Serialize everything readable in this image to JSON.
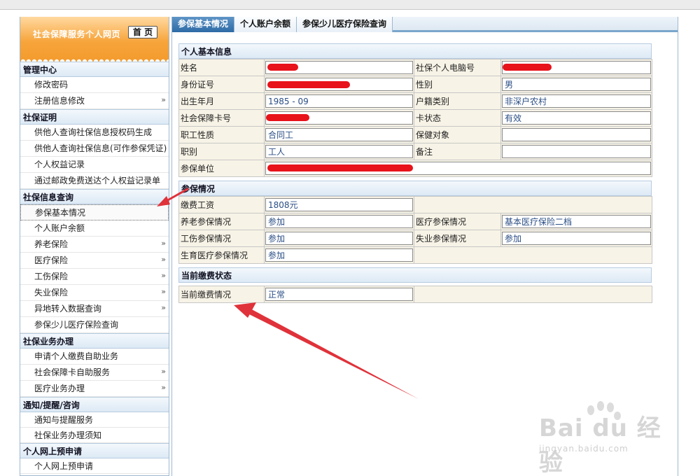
{
  "sidebar": {
    "title": "社会保障服务个人网页",
    "home_button": "首 页",
    "sections": [
      {
        "title": "管理中心",
        "items": [
          {
            "label": "修改密码",
            "arrow": false
          },
          {
            "label": "注册信息修改",
            "arrow": true
          }
        ]
      },
      {
        "title": "社保证明",
        "items": [
          {
            "label": "供他人查询社保信息授权码生成",
            "arrow": false
          },
          {
            "label": "供他人查询社保信息(可作参保凭证)",
            "arrow": false
          },
          {
            "label": "个人权益记录",
            "arrow": false
          },
          {
            "label": "通过邮政免费送达个人权益记录单",
            "arrow": false
          }
        ]
      },
      {
        "title": "社保信息查询",
        "items": [
          {
            "label": "参保基本情况",
            "arrow": false,
            "active": true
          },
          {
            "label": "个人账户余额",
            "arrow": false
          },
          {
            "label": "养老保险",
            "arrow": true
          },
          {
            "label": "医疗保险",
            "arrow": true
          },
          {
            "label": "工伤保险",
            "arrow": true
          },
          {
            "label": "失业保险",
            "arrow": true
          },
          {
            "label": "异地转入数据查询",
            "arrow": true
          },
          {
            "label": "参保少儿医疗保险查询",
            "arrow": false
          }
        ]
      },
      {
        "title": "社保业务办理",
        "items": [
          {
            "label": "申请个人缴费自助业务",
            "arrow": false
          },
          {
            "label": "社会保障卡自助服务",
            "arrow": true
          },
          {
            "label": "医疗业务办理",
            "arrow": true
          }
        ]
      },
      {
        "title": "通知/提醒/咨询",
        "items": [
          {
            "label": "通知与提醒服务",
            "arrow": false
          },
          {
            "label": "社保业务办理须知",
            "arrow": false
          }
        ]
      },
      {
        "title": "个人网上预申请",
        "items": [
          {
            "label": "个人网上预申请",
            "arrow": false
          }
        ]
      }
    ],
    "arrow_glyph": "»"
  },
  "tabs": [
    "参保基本情况",
    "个人账户余额",
    "参保少儿医疗保险查询"
  ],
  "basic_info": {
    "title": "个人基本信息",
    "name_label": "姓名",
    "name_value": "",
    "pc_no_label": "社保个人电脑号",
    "pc_no_value": "",
    "id_label": "身份证号",
    "id_value": "",
    "gender_label": "性别",
    "gender_value": "男",
    "birth_label": "出生年月",
    "birth_value": "1985 - 09",
    "hukou_label": "户籍类别",
    "hukou_value": "非深户农村",
    "card_label": "社会保障卡号",
    "card_value": "",
    "card_status_label": "卡状态",
    "card_status_value": "有效",
    "job_type_label": "职工性质",
    "job_type_value": "合同工",
    "health_obj_label": "保健对象",
    "health_obj_value": "",
    "rank_label": "职别",
    "rank_value": "工人",
    "remark_label": "备注",
    "remark_value": "",
    "employer_label": "参保单位",
    "employer_value": ""
  },
  "insurance": {
    "title": "参保情况",
    "wage_label": "缴费工资",
    "wage_value": "1808元",
    "pension_label": "养老参保情况",
    "pension_value": "参加",
    "medical_label": "医疗参保情况",
    "medical_value": "基本医疗保险二档",
    "injury_label": "工伤参保情况",
    "injury_value": "参加",
    "unemp_label": "失业参保情况",
    "unemp_value": "参加",
    "maternity_label": "生育医疗参保情况",
    "maternity_value": "参加"
  },
  "payment": {
    "title": "当前缴费状态",
    "status_label": "当前缴费情况",
    "status_value": "正常"
  },
  "watermark": {
    "logo": "Bai du 经验",
    "url": "jingyan.baidu.com"
  },
  "colors": {
    "accent": "#2d6aa5",
    "orange": "#f39a2c",
    "redaction": "#e8121a",
    "annotation_arrow": "#e0323a"
  }
}
